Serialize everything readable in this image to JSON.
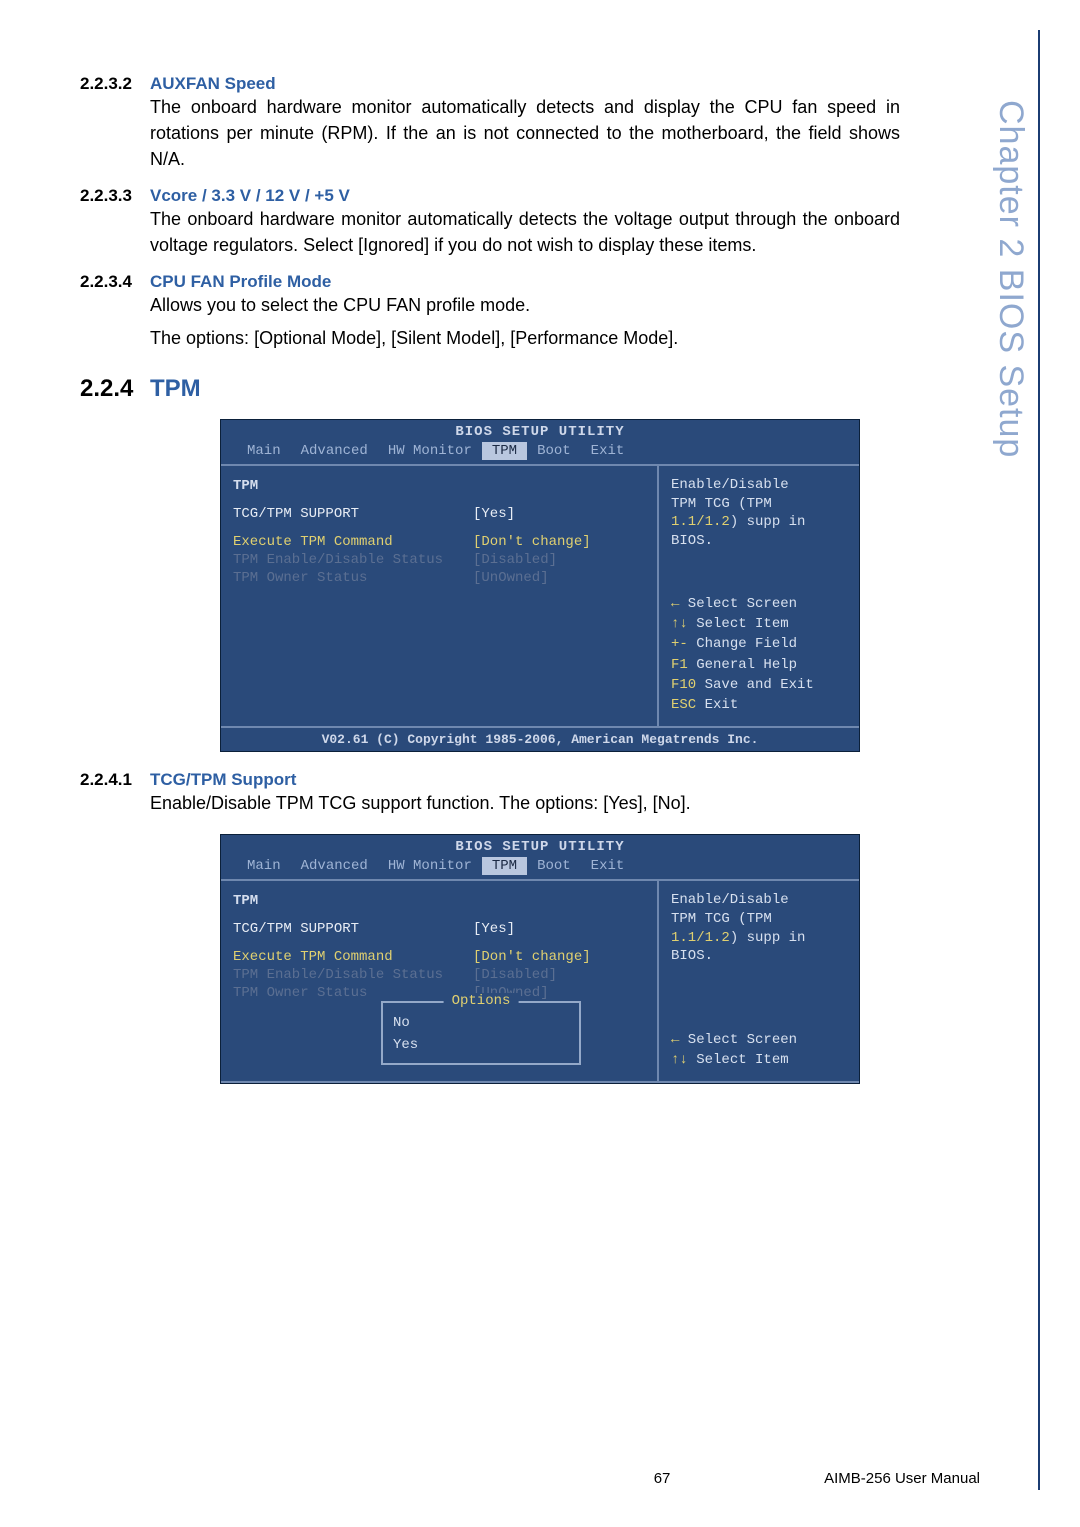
{
  "side_tab": "Chapter 2   BIOS Setup",
  "sections": {
    "s2232": {
      "num": "2.2.3.2",
      "title": "AUXFAN Speed",
      "body": "The onboard hardware monitor automatically detects and display the CPU fan speed in rotations per minute (RPM). If the an is not connected to the motherboard, the field shows N/A."
    },
    "s2233": {
      "num": "2.2.3.3",
      "title": "Vcore / 3.3 V / 12 V / +5 V",
      "body": "The onboard hardware monitor automatically detects the voltage output through the onboard voltage regulators. Select [Ignored] if you do not wish to display these items."
    },
    "s2234": {
      "num": "2.2.3.4",
      "title": "CPU FAN Profile Mode",
      "body1": "Allows you to select the CPU FAN profile mode.",
      "body2": "The options: [Optional Mode], [Silent Model], [Performance Mode]."
    },
    "s224": {
      "num": "2.2.4",
      "title": "TPM"
    },
    "s2241": {
      "num": "2.2.4.1",
      "title": "TCG/TPM Support",
      "body": "Enable/Disable TPM TCG support function. The options: [Yes], [No]."
    }
  },
  "bios_common": {
    "title": "BIOS SETUP UTILITY",
    "menu": {
      "main": "Main",
      "advanced": "Advanced",
      "hw": "HW Monitor",
      "tpm": "TPM",
      "boot": "Boot",
      "exit": "Exit"
    },
    "left_heading": "TPM",
    "rows": {
      "r1": {
        "label": "TCG/TPM SUPPORT",
        "value": "[Yes]"
      },
      "r2": {
        "label": "Execute TPM Command",
        "value": "[Don't change]"
      },
      "r3": {
        "label": "TPM Enable/Disable Status",
        "value": "[Disabled]"
      },
      "r4": {
        "label": "TPM Owner Status",
        "value": "[UnOwned]"
      }
    },
    "help": {
      "line1": "Enable/Disable",
      "line2": "TPM TCG (TPM",
      "line3a": "1.1/1.2",
      "line3b": ") supp in",
      "line4": "BIOS."
    },
    "keys": {
      "k1a": "←",
      "k1b": " Select Screen",
      "k2a": "↑↓",
      "k2b": " Select Item",
      "k3a": "+-",
      "k3b": " Change Field",
      "k4a": "F1",
      "k4b": "  General Help",
      "k5a": "F10",
      "k5b": " Save and Exit",
      "k6a": "ESC",
      "k6b": " Exit"
    },
    "footer": "V02.61 (C) Copyright 1985-2006, American Megatrends Inc."
  },
  "bios2_popup": {
    "title": "Options",
    "opt1": "No",
    "opt2": "Yes"
  },
  "footer": {
    "page": "67",
    "doc": "AIMB-256 User Manual"
  }
}
